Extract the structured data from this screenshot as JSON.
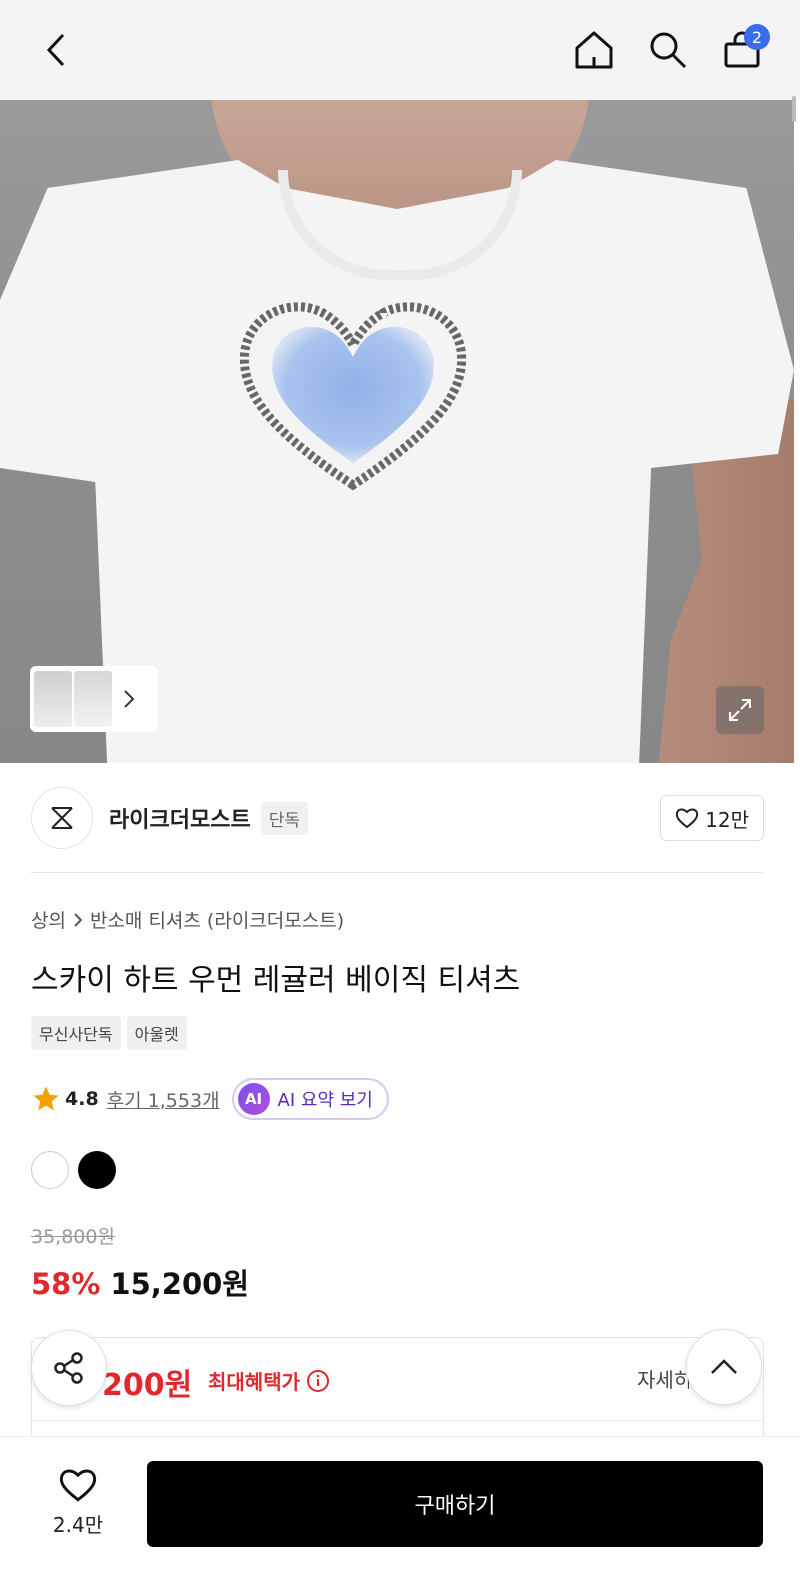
{
  "header": {
    "cart_count": "2"
  },
  "brand": {
    "name": "라이크더모스트",
    "exclusive_tag": "단독",
    "like_count": "12만"
  },
  "breadcrumb": {
    "category": "상의",
    "subcategory": "반소매 티셔츠 (라이크더모스트)"
  },
  "product": {
    "title": "스카이 하트 우먼 레귤러 베이직 티셔츠",
    "tags": [
      "무신사단독",
      "아울렛"
    ],
    "rating": "4.8",
    "review_link": "후기 1,553개",
    "ai_badge": "AI",
    "ai_summary_label": "AI 요약 보기",
    "colors": [
      "#ffffff",
      "#000000"
    ],
    "original_price": "35,800원",
    "discount": "58%",
    "price": "15,200원"
  },
  "benefit": {
    "price": "200원",
    "label": "최대혜택가",
    "detail": "자세히"
  },
  "bottom": {
    "wish_count": "2.4만",
    "buy_label": "구매하기"
  }
}
